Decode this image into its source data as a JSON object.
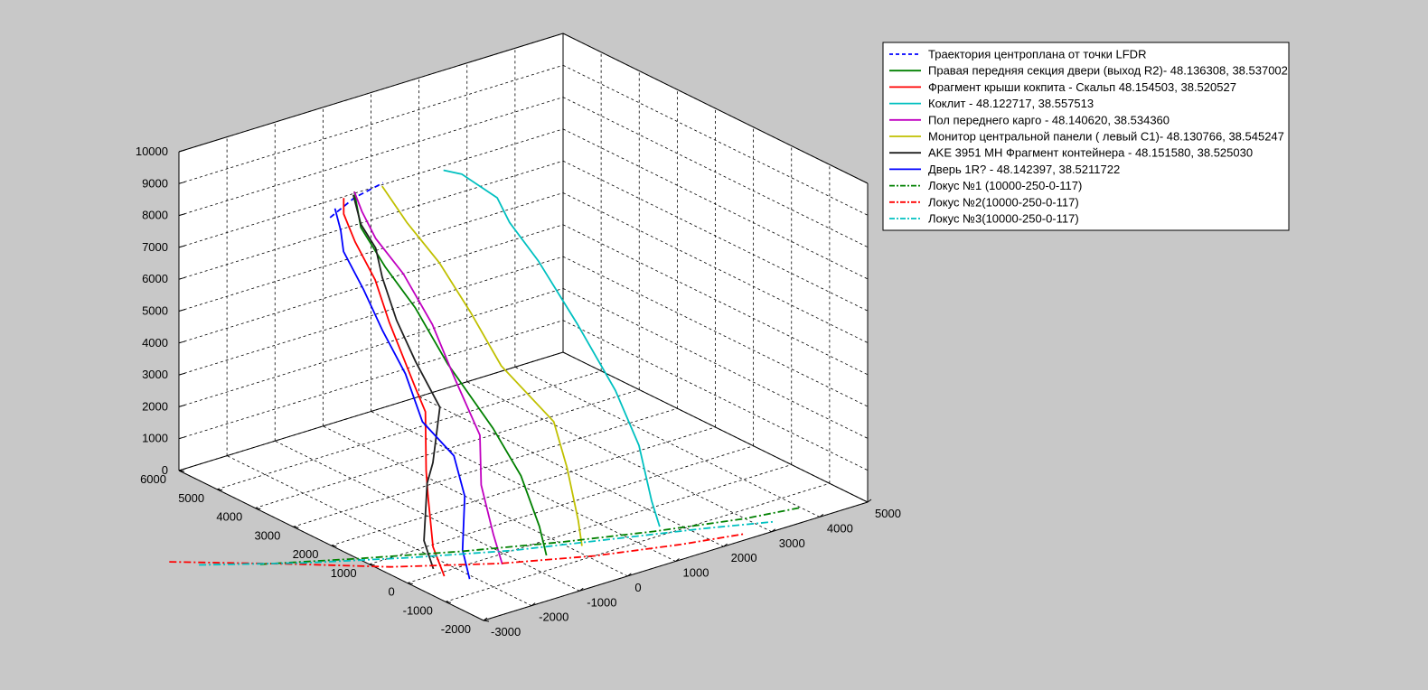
{
  "chart_data": {
    "type": "line3d",
    "grid": true,
    "legend_position": "top-right",
    "axes": {
      "x": {
        "ticks": [
          -3000,
          -2000,
          -1000,
          0,
          1000,
          2000,
          3000,
          4000,
          5000
        ],
        "labels": [
          "-3000",
          "-2000",
          "-1000",
          "0",
          "1000",
          "2000",
          "3000",
          "4000",
          "5000"
        ]
      },
      "y": {
        "ticks": [
          -2000,
          -1000,
          0,
          1000,
          2000,
          3000,
          4000,
          5000,
          6000
        ],
        "labels": [
          "-2000",
          "-1000",
          "0",
          "1000",
          "2000",
          "3000",
          "4000",
          "5000",
          "6000"
        ]
      },
      "z": {
        "ticks": [
          0,
          1000,
          2000,
          3000,
          4000,
          5000,
          6000,
          7000,
          8000,
          9000,
          10000
        ],
        "labels": [
          "0",
          "1000",
          "2000",
          "3000",
          "4000",
          "5000",
          "6000",
          "7000",
          "8000",
          "9000",
          "10000"
        ]
      }
    },
    "series": [
      {
        "name": "Траектория центроплана от точки LFDR",
        "color": "#0000ff",
        "style": "dashed",
        "points": [
          [
            -1200,
            4300,
            8100
          ],
          [
            -450,
            4600,
            8200
          ],
          [
            300,
            4800,
            8200
          ]
        ]
      },
      {
        "name": "Правая передняя секция двери (выход R2)- 48.136308, 38.537002",
        "color": "#008000",
        "style": "solid",
        "points": [
          [
            -500,
            -500,
            0
          ],
          [
            -250,
            0,
            500
          ],
          [
            0,
            800,
            1500
          ],
          [
            50,
            1600,
            2500
          ],
          [
            -100,
            2600,
            4000
          ],
          [
            -300,
            3200,
            5500
          ],
          [
            -450,
            3800,
            6500
          ],
          [
            -400,
            4500,
            7300
          ],
          [
            -300,
            4800,
            8200
          ]
        ]
      },
      {
        "name": "Фрагмент крыши кокпита - Скальп 48.154503, 38.520527",
        "color": "#ff0000",
        "style": "solid",
        "points": [
          [
            -2350,
            -150,
            0
          ],
          [
            -2150,
            400,
            500
          ],
          [
            -1700,
            1100,
            1500
          ],
          [
            -1500,
            1400,
            2000
          ],
          [
            -800,
            2300,
            3000
          ],
          [
            -700,
            2700,
            3500
          ],
          [
            -600,
            3500,
            5000
          ],
          [
            -500,
            4000,
            6000
          ],
          [
            -600,
            4400,
            7000
          ],
          [
            -600,
            4700,
            7700
          ],
          [
            -600,
            4700,
            8200
          ]
        ]
      },
      {
        "name": "Коклит - 48.122717, 38.557513",
        "color": "#00c0c0",
        "style": "solid",
        "points": [
          [
            1700,
            -700,
            0
          ],
          [
            1850,
            -300,
            500
          ],
          [
            2300,
            600,
            1500
          ],
          [
            2600,
            1600,
            2500
          ],
          [
            2600,
            2600,
            4000
          ],
          [
            2500,
            3500,
            5500
          ],
          [
            2300,
            4000,
            6500
          ],
          [
            2200,
            4200,
            7200
          ],
          [
            1700,
            4500,
            8000
          ],
          [
            1400,
            4600,
            8200
          ]
        ]
      },
      {
        "name": "Пол переднего карго - 48.140620, 38.534360",
        "color": "#c000c0",
        "style": "solid",
        "points": [
          [
            -1300,
            -350,
            0
          ],
          [
            -1050,
            200,
            500
          ],
          [
            -750,
            900,
            1500
          ],
          [
            -300,
            1500,
            2500
          ],
          [
            -200,
            2300,
            3800
          ],
          [
            -100,
            3000,
            5000
          ],
          [
            -150,
            3700,
            6200
          ],
          [
            -250,
            4300,
            7000
          ],
          [
            -300,
            4600,
            7700
          ],
          [
            -300,
            4800,
            8200
          ]
        ]
      },
      {
        "name": "Монитор центральной панели ( левый С1)- 48.130766, 38.545247",
        "color": "#c0c000",
        "style": "solid",
        "points": [
          [
            200,
            -550,
            0
          ],
          [
            400,
            -200,
            500
          ],
          [
            800,
            600,
            1500
          ],
          [
            1000,
            1200,
            2500
          ],
          [
            700,
            2200,
            3800
          ],
          [
            700,
            3000,
            5000
          ],
          [
            600,
            3700,
            6200
          ],
          [
            400,
            4300,
            7200
          ],
          [
            200,
            4700,
            8200
          ]
        ]
      },
      {
        "name": "AKE 3951 MH Фрагмент контейнера - 48.151580, 38.525030",
        "color": "#202020",
        "style": "solid",
        "points": [
          [
            -2300,
            200,
            0
          ],
          [
            -2100,
            700,
            500
          ],
          [
            -1400,
            1500,
            1500
          ],
          [
            -1200,
            1600,
            2000
          ],
          [
            -500,
            2300,
            3000
          ],
          [
            -450,
            3000,
            4000
          ],
          [
            -450,
            3500,
            5000
          ],
          [
            -350,
            4000,
            6000
          ],
          [
            -250,
            4300,
            6700
          ],
          [
            -400,
            4500,
            7400
          ],
          [
            -400,
            4700,
            8200
          ]
        ]
      },
      {
        "name": "Дверь 1R? - 48.142397, 38.5211722",
        "color": "#0000ff",
        "style": "solid",
        "points": [
          [
            -2100,
            -500,
            0
          ],
          [
            -1850,
            0,
            500
          ],
          [
            -1250,
            700,
            1500
          ],
          [
            -1000,
            1300,
            2300
          ],
          [
            -1100,
            2000,
            3000
          ],
          [
            -900,
            2700,
            4000
          ],
          [
            -900,
            3300,
            5000
          ],
          [
            -900,
            3800,
            6000
          ],
          [
            -1000,
            4200,
            7000
          ],
          [
            -900,
            4400,
            7500
          ],
          [
            -900,
            4550,
            8100
          ]
        ]
      },
      {
        "name": "Локус №1 (10000-250-0-117)",
        "color": "#008000",
        "style": "dashdot",
        "points": [
          [
            -4400,
            2100,
            0
          ],
          [
            -3000,
            1300,
            0
          ],
          [
            -1500,
            500,
            0
          ],
          [
            0,
            -200,
            0
          ],
          [
            1500,
            -800,
            0
          ],
          [
            3000,
            -1300,
            0
          ],
          [
            4000,
            -1500,
            0
          ]
        ]
      },
      {
        "name": "Локус №2(10000-250-0-117)",
        "color": "#ff0000",
        "style": "dashdot",
        "points": [
          [
            -5500,
            3100,
            0
          ],
          [
            -4000,
            1800,
            0
          ],
          [
            -2800,
            700,
            0
          ],
          [
            -1300,
            -300,
            0
          ],
          [
            100,
            -1000,
            0
          ],
          [
            1500,
            -1500,
            0
          ],
          [
            2600,
            -1800,
            0
          ]
        ]
      },
      {
        "name": "Локус №3(10000-250-0-117)",
        "color": "#00c0c0",
        "style": "dashdot",
        "points": [
          [
            -5200,
            2700,
            0
          ],
          [
            -3800,
            1700,
            0
          ],
          [
            -2300,
            800,
            0
          ],
          [
            -800,
            0,
            0
          ],
          [
            700,
            -600,
            0
          ],
          [
            2200,
            -1200,
            0
          ],
          [
            3300,
            -1700,
            0
          ]
        ]
      }
    ]
  }
}
